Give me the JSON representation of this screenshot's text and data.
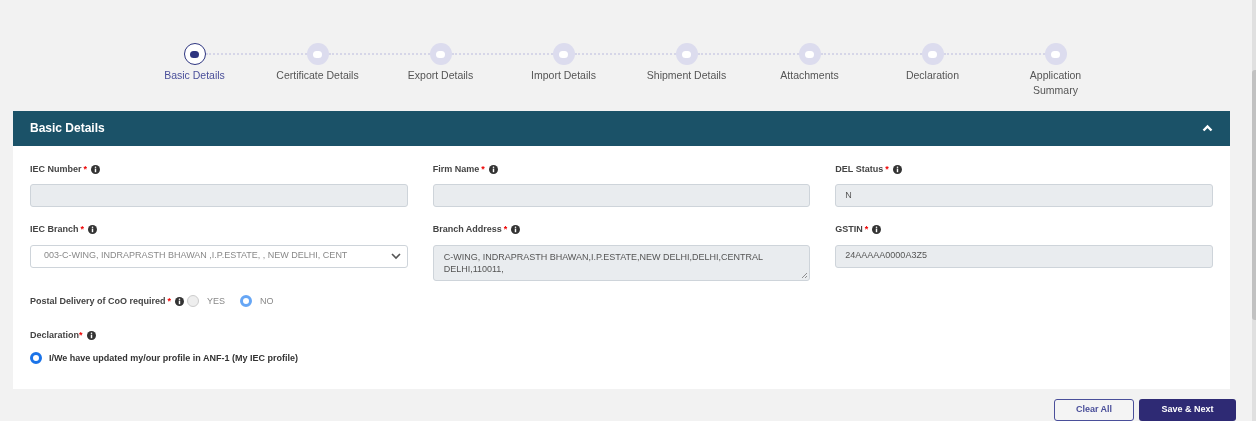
{
  "steps": [
    {
      "label": "Basic Details",
      "selected": true
    },
    {
      "label": "Certificate Details",
      "selected": false
    },
    {
      "label": "Export Details",
      "selected": false
    },
    {
      "label": "Import Details",
      "selected": false
    },
    {
      "label": "Shipment Details",
      "selected": false
    },
    {
      "label": "Attachments",
      "selected": false
    },
    {
      "label": "Declaration",
      "selected": false
    },
    {
      "label": "Application Summary",
      "selected": false
    }
  ],
  "section": {
    "title": "Basic Details",
    "expanded": true
  },
  "fields": [
    {
      "label": "IEC Number",
      "required_mark": "*",
      "kind": "input"
    },
    {
      "label": "Firm Name",
      "required_mark": "*",
      "kind": "input"
    },
    {
      "label": "DEL Status",
      "required_mark": "*",
      "kind": "input",
      "value": "N"
    },
    {
      "label": "IEC Branch",
      "required_mark": "*",
      "kind": "select",
      "value": "003-C-WING, INDRAPRASTH BHAWAN ,I.P.ESTATE, , NEW DELHI, CENT"
    },
    {
      "label": "Branch Address",
      "required_mark": "*",
      "kind": "textarea",
      "value": "C-WING, INDRAPRASTH BHAWAN,I.P.ESTATE,NEW DELHI,DELHI,CENTRAL DELHI,110011,"
    },
    {
      "label": "GSTIN",
      "required_mark": "*",
      "kind": "input",
      "value": "24AAAAA0000A3Z5"
    }
  ],
  "postal": {
    "label": "Postal Delivery of CoO required",
    "required_mark": "*",
    "options": [
      {
        "label": "YES",
        "selected": false
      },
      {
        "label": "NO",
        "selected": true
      }
    ]
  },
  "declaration": {
    "label": "Declaration",
    "required_mark": "*",
    "options": [
      {
        "label": "I/We have updated my/our profile in ANF-1 (My IEC profile)",
        "selected": true
      }
    ]
  },
  "buttons": [
    {
      "label": "Clear All",
      "kind": "secondary"
    },
    {
      "label": "Save & Next",
      "kind": "primary"
    }
  ]
}
